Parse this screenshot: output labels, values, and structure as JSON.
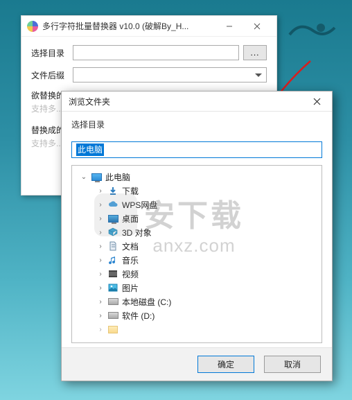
{
  "main": {
    "title": "多行字符批量替换器 v10.0 (破解By_H...",
    "labels": {
      "selectDir": "选择目录",
      "fileExt": "文件后缀",
      "replaceFrom": "欲替换的",
      "replaceFromHint": "支持多...",
      "replaceTo": "替换成的",
      "replaceToHint": "支持多..."
    },
    "browse": "..."
  },
  "dialog": {
    "title": "浏览文件夹",
    "instruction": "选择目录",
    "pathValue": "此电脑",
    "tree": {
      "root": "此电脑",
      "items": [
        {
          "label": "下载",
          "icon": "folder",
          "color": "#3b82c9"
        },
        {
          "label": "WPS网盘",
          "icon": "cloud",
          "color": "#3b82c9"
        },
        {
          "label": "桌面",
          "icon": "folder",
          "color": "#2f87d0"
        },
        {
          "label": "3D 对象",
          "icon": "cube",
          "color": "#2c98c8"
        },
        {
          "label": "文档",
          "icon": "doc",
          "color": "#6f8fa8"
        },
        {
          "label": "音乐",
          "icon": "music",
          "color": "#2f87d0"
        },
        {
          "label": "视频",
          "icon": "video",
          "color": "#5a5a5a"
        },
        {
          "label": "图片",
          "icon": "image",
          "color": "#2c98c8"
        },
        {
          "label": "本地磁盘 (C:)",
          "icon": "drive",
          "color": "#888"
        },
        {
          "label": "软件 (D:)",
          "icon": "drive",
          "color": "#888"
        }
      ]
    },
    "buttons": {
      "ok": "确定",
      "cancel": "取消"
    }
  },
  "watermark": {
    "line1": "安下载",
    "line2": "anxz.com"
  }
}
